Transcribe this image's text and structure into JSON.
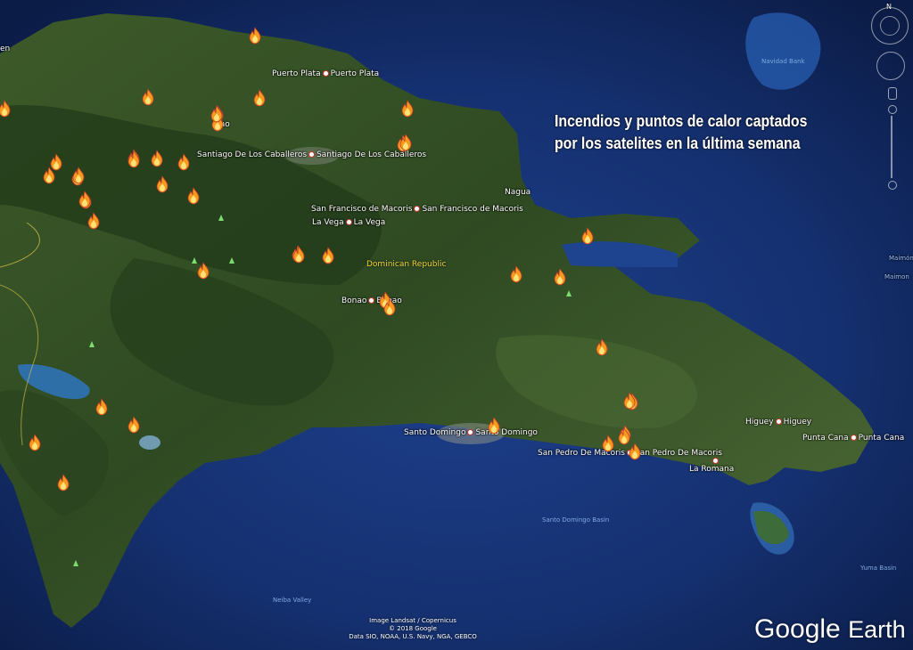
{
  "headline": {
    "line1": "Incendios y puntos de calor captados",
    "line2": "por los satelites en la última semana"
  },
  "country_label": "Dominican Republic",
  "cities": [
    {
      "name": "Puerto Plata",
      "name2": "Puerto Plata"
    },
    {
      "name": "Santiago De Los Caballeros",
      "name2": "Santiago De Los Caballeros"
    },
    {
      "name": "Nagua"
    },
    {
      "name": "San Francisco de Macoris",
      "name2": "San Francisco de Macoris"
    },
    {
      "name": "La Vega",
      "name2": "La Vega"
    },
    {
      "name": "Bonao",
      "name2": "Bonao"
    },
    {
      "name": "Santo Domingo",
      "name2": "Santo Domingo"
    },
    {
      "name": "San Pedro De Macoris",
      "name2": "San Pedro De Macoris"
    },
    {
      "name": "La Romana"
    },
    {
      "name": "Higuey",
      "name2": "Higuey"
    },
    {
      "name": "Punta Cana",
      "name2": "Punta Cana"
    },
    {
      "name": "Mao"
    },
    {
      "name": "en"
    },
    {
      "name": "Maimón"
    },
    {
      "name": "Maimon"
    }
  ],
  "water_features": [
    "Navidad Bank",
    "Santo Domingo Basin",
    "Yuma Basin",
    "Neiba Valley"
  ],
  "credits": {
    "line1": "Image Landsat / Copernicus",
    "line2": "© 2018 Google",
    "line3": "Data SIO, NOAA, U.S. Navy, NGA, GEBCO"
  },
  "brand": {
    "google": "Google",
    "earth": "Earth"
  },
  "compass_letter": "N",
  "fire_count": 44,
  "colors": {
    "ocean": "#142e6e",
    "land": "#3f5a2a",
    "fire": "#f59a1d",
    "text": "#ffffff",
    "country_label": "#f1d83a"
  }
}
